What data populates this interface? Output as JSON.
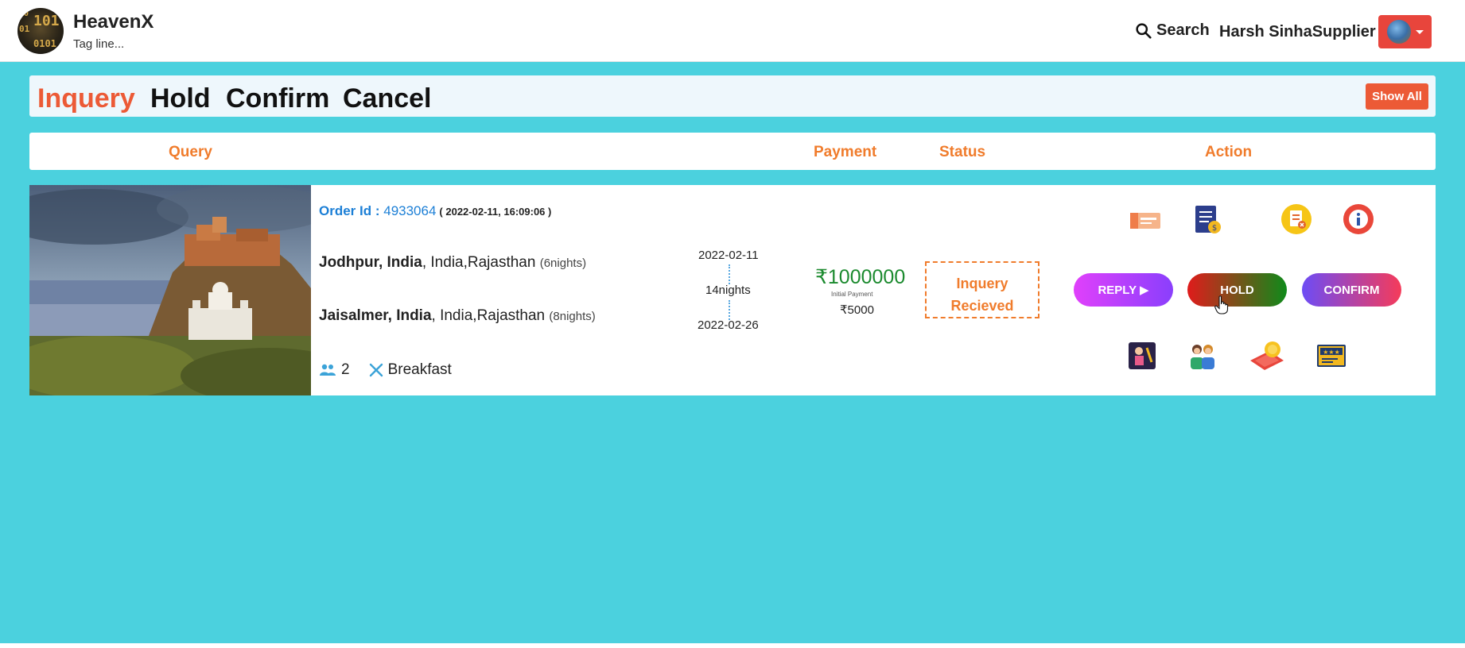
{
  "header": {
    "brand": "HeavenX",
    "tagline": "Tag line...",
    "search_label": "Search",
    "user_name": "Harsh SinhaSupplier"
  },
  "tabs": [
    {
      "label": "Inquery",
      "active": true
    },
    {
      "label": "Hold",
      "active": false
    },
    {
      "label": "Confirm",
      "active": false
    },
    {
      "label": "Cancel",
      "active": false
    }
  ],
  "show_all_label": "Show All",
  "columns": {
    "query": "Query",
    "payment": "Payment",
    "status": "Status",
    "action": "Action"
  },
  "order": {
    "order_label": "Order Id : ",
    "order_id": "4933064",
    "order_date": "( 2022-02-11, 16:09:06 )",
    "destinations": [
      {
        "city": "Jodhpur, India",
        "region": ", India,Rajasthan",
        "nights": "(6nights)"
      },
      {
        "city": "Jaisalmer, India",
        "region": ", India,Rajasthan",
        "nights": "(8nights)"
      }
    ],
    "travellers": "2",
    "meal": "Breakfast",
    "start_date": "2022-02-11",
    "total_nights": "14nights",
    "end_date": "2022-02-26",
    "amount": "₹1000000",
    "initial_label": "Initial Payment",
    "initial_amount": "₹5000",
    "status_line1": "Inquery",
    "status_line2": "Recieved",
    "reply_label": "REPLY ▶",
    "hold_label": "HOLD",
    "confirm_label": "CONFIRM"
  },
  "colors": {
    "accent": "#ec5a36",
    "header_orange": "#f07c2c",
    "background": "#4bd1de",
    "link_blue": "#1c7fd6",
    "amount_green": "#1b8a2e"
  }
}
